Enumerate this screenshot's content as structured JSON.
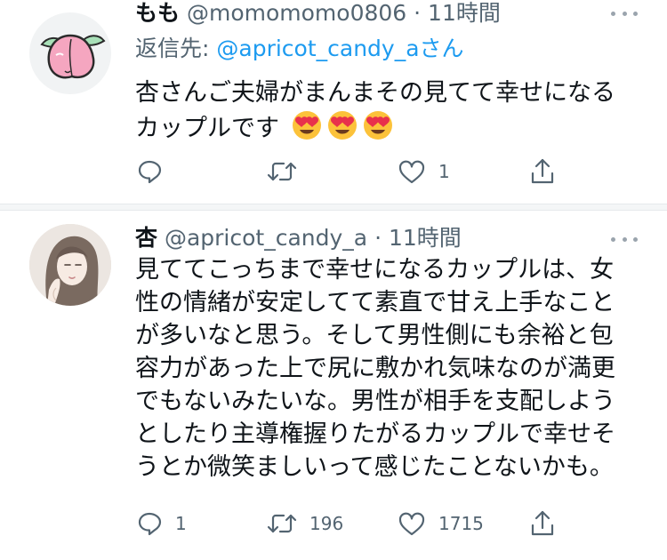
{
  "tweets": [
    {
      "display_name": "もも",
      "handle": "@momomomo0806",
      "time_sep": "·",
      "time": "11時間",
      "reply_prefix": "返信先: ",
      "reply_handle": "@apricot_candy_a",
      "reply_suffix": "さん",
      "lines": [
        "杏さんご夫婦がまんまその見てて幸せになる",
        "カップルです"
      ],
      "avatar_icon": "peach-icon",
      "stats": {
        "reply": "",
        "retweet": "",
        "like": "1"
      }
    },
    {
      "display_name": "杏",
      "handle": "@apricot_candy_a",
      "time_sep": "·",
      "time": "11時間",
      "lines": [
        "見ててこっちまで幸せになるカップルは、女",
        "性の情緒が安定してて素直で甘え上手なこと",
        "が多いなと思う。そして男性側にも余裕と包",
        "容力があった上で尻に敷かれ気味なのが満更",
        "でもないみたいな。男性が相手を支配しよう",
        "としたり主導権握りたがるカップルで幸せそ",
        "うとか微笑ましいって感じたことないかも。"
      ],
      "avatar_icon": "illustrated-woman-avatar",
      "stats": {
        "reply": "1",
        "retweet": "196",
        "like": "1715"
      }
    }
  ],
  "colors": {
    "link": "#1d9bf0",
    "secondary": "#536471",
    "text": "#0f1419"
  }
}
